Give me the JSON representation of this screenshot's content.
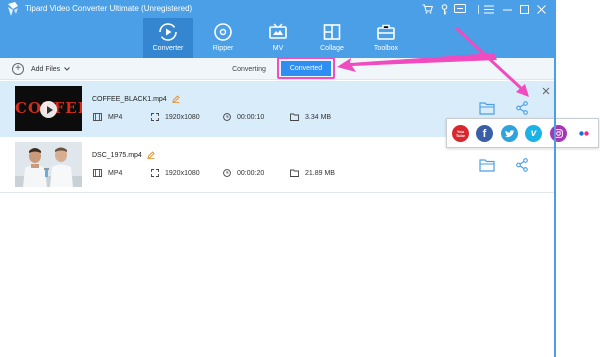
{
  "window": {
    "title": "Tipard Video Converter Ultimate (Unregistered)",
    "controls": [
      "cart-icon",
      "key-icon",
      "message-icon",
      "menu-icon",
      "minimize-icon",
      "maximize-icon",
      "close-icon"
    ]
  },
  "nav": {
    "tabs": [
      {
        "label": "Converter",
        "icon": "converter-icon",
        "active": true
      },
      {
        "label": "Ripper",
        "icon": "ripper-icon",
        "active": false
      },
      {
        "label": "MV",
        "icon": "mv-icon",
        "active": false
      },
      {
        "label": "Collage",
        "icon": "collage-icon",
        "active": false
      },
      {
        "label": "Toolbox",
        "icon": "toolbox-icon",
        "active": false
      }
    ]
  },
  "toolbar": {
    "add_files_label": "Add Files",
    "subtabs": {
      "converting": "Converting",
      "converted": "Converted"
    },
    "active_subtab": "Converted"
  },
  "files": [
    {
      "name": "COFFEE_BLACK1.mp4",
      "format": "MP4",
      "resolution": "1920x1080",
      "duration": "00:00:10",
      "size": "3.34 MB",
      "thumb_text": "COFFEE",
      "thumb_icon": "play-icon"
    },
    {
      "name": "DSC_1975.mp4",
      "format": "MP4",
      "resolution": "1920x1080",
      "duration": "00:00:20",
      "size": "21.89 MB"
    }
  ],
  "share_menu": {
    "services": [
      "youtube-icon",
      "facebook-icon",
      "twitter-icon",
      "vimeo-icon",
      "instagram-icon",
      "flickr-icon"
    ],
    "youtube_text": "You Tube"
  },
  "colors": {
    "header": "#4a9fe6",
    "active_tab": "#3586d1",
    "converted_button": "#2e8ef3",
    "highlight_pink": "#f24ec1",
    "selected_row": "#d9ecfa"
  }
}
